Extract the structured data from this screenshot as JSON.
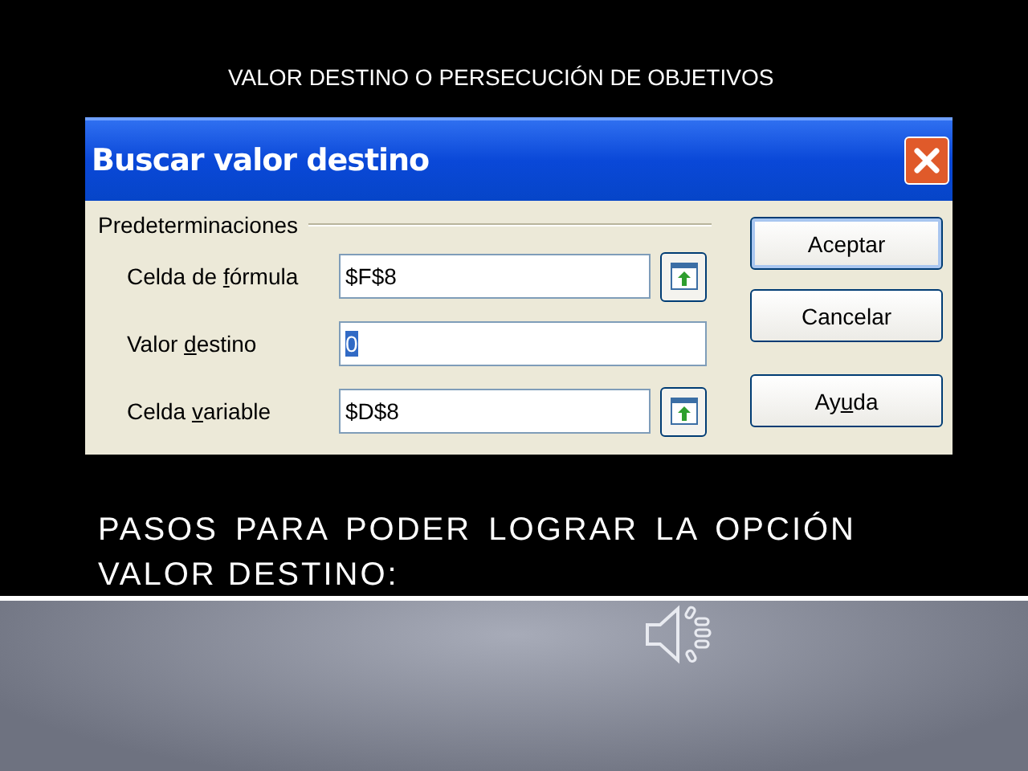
{
  "slide_title": "VALOR  DESTINO  O   PERSECUCIÓN DE OBJETIVOS",
  "dialog": {
    "title": "Buscar valor destino",
    "group_label": "Predeterminaciones",
    "fields": [
      {
        "label": {
          "pre": "Celda de ",
          "key": "f",
          "post": "órmula"
        },
        "value": "$F$8",
        "value_selected": false,
        "picker": true
      },
      {
        "label": {
          "pre": "Valor ",
          "key": "d",
          "post": "estino"
        },
        "value": "0",
        "value_selected": true,
        "picker": false
      },
      {
        "label": {
          "pre": "Celda ",
          "key": "v",
          "post": "ariable"
        },
        "value": "$D$8",
        "value_selected": false,
        "picker": true
      }
    ],
    "buttons": [
      {
        "label": {
          "pre": "Aceptar"
        },
        "default": true
      },
      {
        "label": {
          "pre": "Cancelar"
        },
        "default": false
      },
      {
        "label": {
          "pre": "Ay",
          "key": "u",
          "post": "da"
        },
        "default": false
      }
    ]
  },
  "heading": "PASOS  PARA  PODER  LOGRAR   LA  OPCIÓN VALOR  DESTINO:"
}
